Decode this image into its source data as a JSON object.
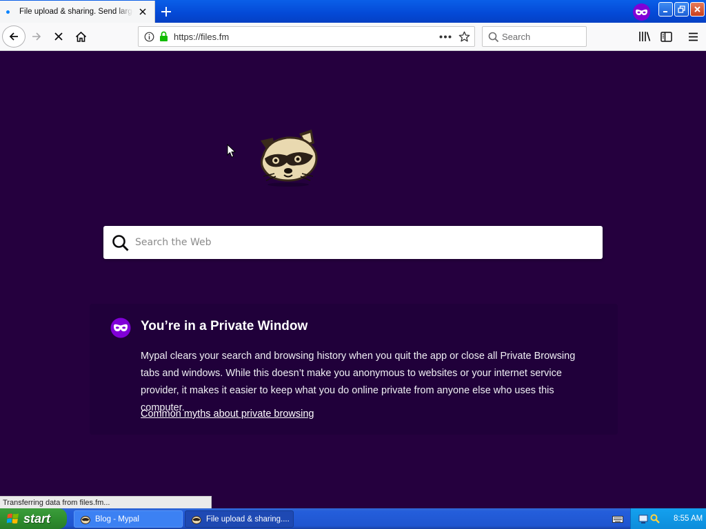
{
  "browser": {
    "tab": {
      "title": "File upload & sharing. Send large files"
    },
    "url": "https://files.fm",
    "search_placeholder": "Search"
  },
  "page": {
    "search_placeholder": "Search the Web",
    "private_title": "You’re in a Private Window",
    "private_text": "Mypal clears your search and browsing history when you quit the app or close all Private Browsing tabs and windows. While this doesn’t make you anonymous to websites or your internet service provider, it makes it easier to keep what you do online private from anyone else who uses this computer.",
    "myths_link": "Common myths about private browsing"
  },
  "status": "Transferring data from files.fm...",
  "taskbar": {
    "start_label": "start",
    "tasks": [
      {
        "label": "Blog - Mypal",
        "active": false
      },
      {
        "label": "File upload & sharing....",
        "active": true
      }
    ],
    "clock": "8:55 AM"
  },
  "colors": {
    "page_background": "#25003e",
    "private_purple": "#8000d7",
    "titlebar_blue": "#0449d6",
    "taskbar_blue": "#245edb",
    "start_green": "#3c9e3c"
  },
  "icons": [
    "back-icon",
    "forward-icon",
    "stop-icon",
    "home-icon",
    "info-icon",
    "lock-icon",
    "more-icon",
    "star-icon",
    "search-icon",
    "library-icon",
    "sidebar-icon",
    "menu-icon",
    "raccoon-logo",
    "private-mask-icon",
    "windows-flag-icon",
    "keyboard-icon"
  ]
}
